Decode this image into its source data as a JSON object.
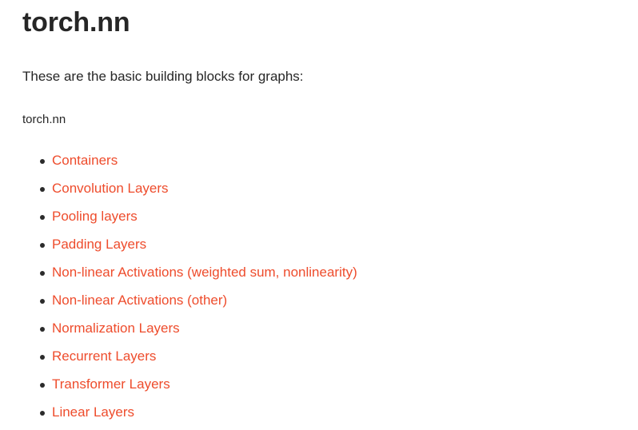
{
  "document": {
    "title": "torch.nn",
    "intro_paragraph": "These are the basic building blocks for graphs:",
    "module_line": "torch.nn",
    "link_color": "#ee4c2c",
    "text_color": "#262626",
    "bullet_color": "#2b2b2b",
    "background_color": "#ffffff",
    "bullet_icon": "bullet-dot-icon",
    "links": [
      {
        "label": "Containers"
      },
      {
        "label": "Convolution Layers"
      },
      {
        "label": "Pooling layers"
      },
      {
        "label": "Padding Layers"
      },
      {
        "label": "Non-linear Activations (weighted sum, nonlinearity)"
      },
      {
        "label": "Non-linear Activations (other)"
      },
      {
        "label": "Normalization Layers"
      },
      {
        "label": "Recurrent Layers"
      },
      {
        "label": "Transformer Layers"
      },
      {
        "label": "Linear Layers"
      }
    ]
  }
}
